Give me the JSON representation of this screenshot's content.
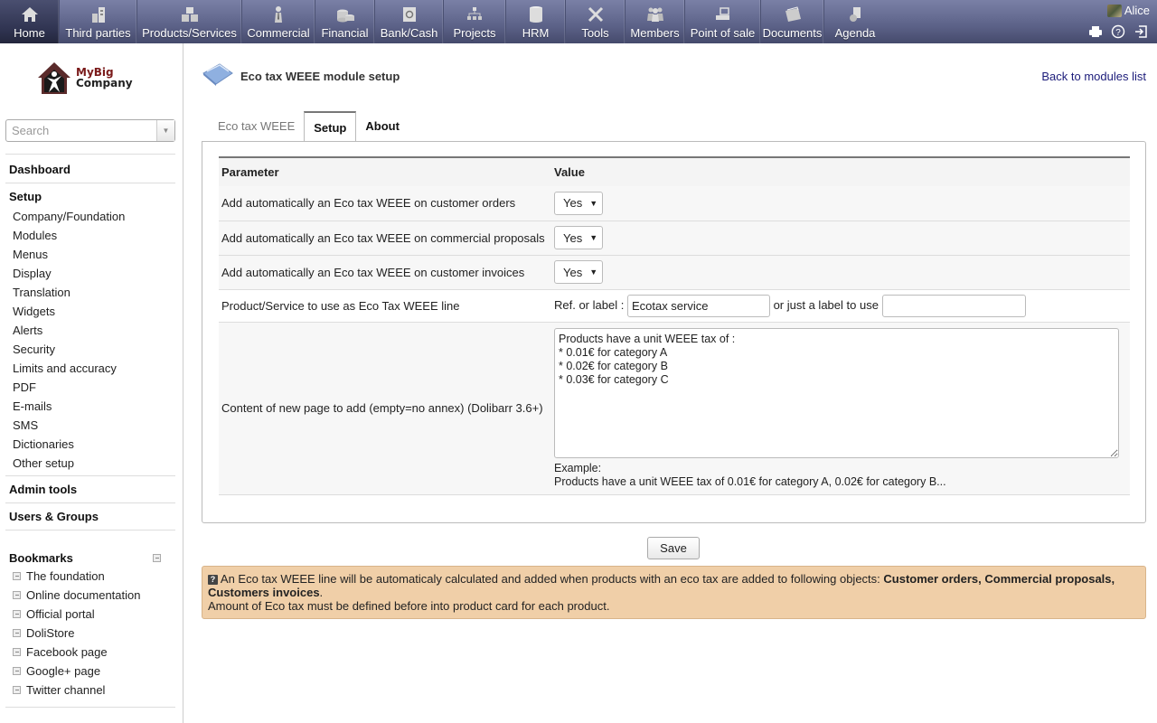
{
  "topmenu": [
    {
      "label": "Home",
      "icon": "home-icon",
      "active": true
    },
    {
      "label": "Third parties",
      "icon": "buildings-icon"
    },
    {
      "label": "Products/Services",
      "icon": "boxes-icon"
    },
    {
      "label": "Commercial",
      "icon": "salesman-icon"
    },
    {
      "label": "Financial",
      "icon": "coins-icon"
    },
    {
      "label": "Bank/Cash",
      "icon": "safe-icon"
    },
    {
      "label": "Projects",
      "icon": "hierarchy-icon"
    },
    {
      "label": "HRM",
      "icon": "cylinder-icon"
    },
    {
      "label": "Tools",
      "icon": "tools-icon"
    },
    {
      "label": "Members",
      "icon": "members-icon"
    },
    {
      "label": "Point of sale",
      "icon": "cash-register-icon"
    },
    {
      "label": "Documents",
      "icon": "folder-icon"
    },
    {
      "label": "Agenda",
      "icon": "agenda-icon"
    }
  ],
  "user": {
    "name": "Alice"
  },
  "sidebar": {
    "logo": {
      "line1": "MyBig",
      "line2": "Company"
    },
    "search_placeholder": "Search",
    "dashboard": "Dashboard",
    "setup": {
      "title": "Setup",
      "items": [
        "Company/Foundation",
        "Modules",
        "Menus",
        "Display",
        "Translation",
        "Widgets",
        "Alerts",
        "Security",
        "Limits and accuracy",
        "PDF",
        "E-mails",
        "SMS",
        "Dictionaries",
        "Other setup"
      ]
    },
    "admin_tools": "Admin tools",
    "users_groups": "Users & Groups",
    "bookmarks": {
      "title": "Bookmarks",
      "items": [
        "The foundation",
        "Online documentation",
        "Official portal",
        "DoliStore",
        "Facebook page",
        "Google+ page",
        "Twitter channel"
      ]
    }
  },
  "main": {
    "title": "Eco tax WEEE module setup",
    "back_link": "Back to modules list",
    "tabs": [
      {
        "label": "Eco tax WEEE",
        "state": "inactive"
      },
      {
        "label": "Setup",
        "state": "active"
      },
      {
        "label": "About",
        "state": "bold"
      }
    ],
    "table": {
      "headers": [
        "Parameter",
        "Value"
      ],
      "rows": [
        {
          "param": "Add automatically an Eco tax WEEE on customer orders",
          "value": "Yes"
        },
        {
          "param": "Add automatically an Eco tax WEEE on commercial proposals",
          "value": "Yes"
        },
        {
          "param": "Add automatically an Eco tax WEEE on customer invoices",
          "value": "Yes"
        }
      ],
      "product_row": {
        "param": "Product/Service to use as Eco Tax WEEE line",
        "ref_label": "Ref. or label :",
        "ref_value": "Ecotax service",
        "or_label": "or just a label to use",
        "label_value": ""
      },
      "content_row": {
        "param": "Content of new page to add (empty=no annex) (Dolibarr 3.6+)",
        "textarea_value": "Products have a unit WEEE tax of :\n* 0.01€ for category A\n* 0.02€ for category B\n* 0.03€ for category C",
        "example_title": "Example:",
        "example_text": "Products have a unit WEEE tax of 0.01€ for category A, 0.02€ for category B..."
      }
    },
    "save_label": "Save",
    "info": {
      "text1": "An Eco tax WEEE line will be automaticaly calculated and added when products with an eco tax are added to following objects: ",
      "bold": "Customer orders, Commercial proposals, Customers invoices",
      "text2": ".",
      "line2": "Amount of Eco tax must be defined before into product card for each product."
    }
  },
  "colors": {
    "topbar": "#5c6288",
    "info_bg": "#f0cfa8",
    "link": "#1c1c7a"
  }
}
